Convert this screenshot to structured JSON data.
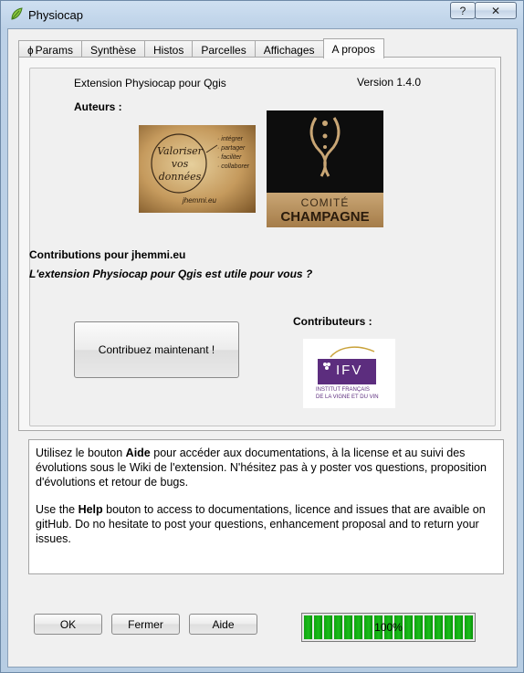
{
  "window": {
    "title": "Physiocap",
    "help_button": "?",
    "close_button": "✕"
  },
  "tabs": [
    {
      "label": "Params",
      "icon": "phi-icon",
      "prefix": "ɸ"
    },
    {
      "label": "Synthèse"
    },
    {
      "label": "Histos"
    },
    {
      "label": "Parcelles"
    },
    {
      "label": "Affichages"
    },
    {
      "label": "A propos",
      "active": true
    }
  ],
  "about": {
    "extension_label": "Extension Physiocap pour Qgis",
    "version": "Version 1.4.0",
    "authors_label": "Auteurs :",
    "valoriser_image": {
      "main": "Valoriser vos données",
      "side": [
        "· intégrer",
        "· partager",
        "· faciliter",
        "· collaborer"
      ],
      "signature": "jhemmi.eu"
    },
    "comite_image": {
      "line1": "COMITÉ",
      "line2": "CHAMPAGNE"
    },
    "contributions_label": "Contributions pour jhemmi.eu",
    "question": "L'extension Physiocap pour Qgis est utile pour vous ?",
    "contribute_button": "Contribuez maintenant !",
    "contributors_label": "Contributeurs :",
    "ifv_logo": {
      "abbr": "IFV",
      "line1": "INSTITUT FRANÇAIS",
      "line2": "DE LA VIGNE ET DU VIN"
    }
  },
  "help_text": {
    "fr_before": "Utilisez le bouton ",
    "fr_bold": "Aide",
    "fr_after": " pour accéder aux documentations, à la license et au suivi des évolutions sous le Wiki de l'extension. N'hésitez pas à y poster vos questions, proposition d'évolutions et retour de bugs.",
    "en_before": "Use the ",
    "en_bold": "Help",
    "en_after": " bouton to access to documentations, licence and issues that are avaible on gitHub. Do no hesitate to post your questions, enhancement proposal and to return your issues."
  },
  "footer": {
    "ok": "OK",
    "close": "Fermer",
    "help": "Aide",
    "progress_label": "100%",
    "progress_value": 1.0
  },
  "colors": {
    "progress_green": "#17b017",
    "ifv_purple": "#5c2d7e"
  }
}
